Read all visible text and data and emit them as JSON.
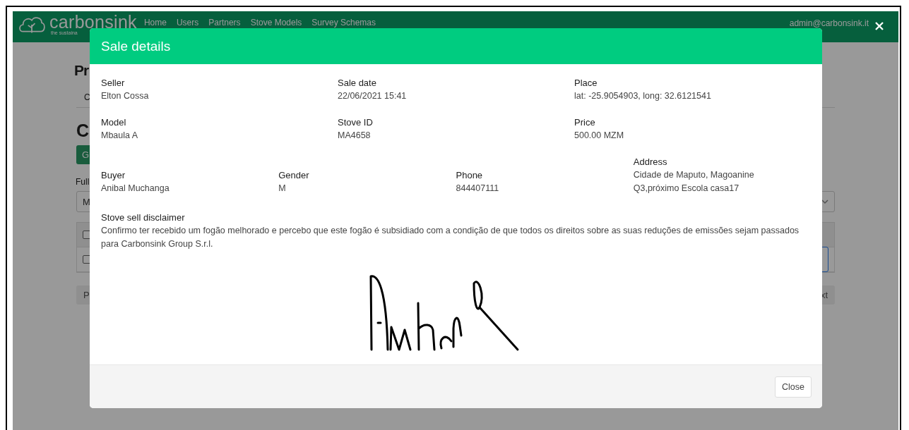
{
  "navbar": {
    "logo": {
      "name": "carbonsink",
      "tagline": "the sustaina"
    },
    "links": [
      {
        "label": "Home"
      },
      {
        "label": "Users"
      },
      {
        "label": "Partners"
      },
      {
        "label": "Stove Models"
      },
      {
        "label": "Survey Schemas"
      }
    ],
    "user": "admin@carbonsink.it"
  },
  "background_page": {
    "title": "Pr",
    "tab": "C",
    "heading": "C",
    "button": "G",
    "field_label": "Full",
    "select_value": "M",
    "table_rows": [
      {
        "checked": false
      },
      {
        "checked": false
      }
    ],
    "pager_left": "P",
    "pager_right": "xt"
  },
  "modal": {
    "title": "Sale details",
    "rows": [
      [
        {
          "label": "Seller",
          "value": "Elton Cossa"
        },
        {
          "label": "Sale date",
          "value": "22/06/2021 15:41"
        },
        {
          "label": "Place",
          "value": "lat: -25.9054903, long: 32.6121541"
        }
      ],
      [
        {
          "label": "Model",
          "value": "Mbaula A"
        },
        {
          "label": "Stove ID",
          "value": "MA4658"
        },
        {
          "label": "Price",
          "value": "500.00 MZM"
        }
      ],
      [
        {
          "label": "Buyer",
          "value": "Anibal Muchanga"
        },
        {
          "label": "Gender",
          "value": "M"
        },
        {
          "label": "Phone",
          "value": "844407111"
        },
        {
          "label": "Address",
          "value": "Cidade de Maputo, Magoanine\nQ3,próximo Escola casa17"
        }
      ]
    ],
    "disclaimer": {
      "label": "Stove sell disclaimer",
      "text": "Confirmo ter recebido um fogão melhorado e percebo que este fogão é subsidiado com a condição de que todos os direitos sobre as suas reduções de emissões sejam passados para Carbonsink Group S.r.l."
    },
    "buttons": [
      "Close"
    ]
  }
}
